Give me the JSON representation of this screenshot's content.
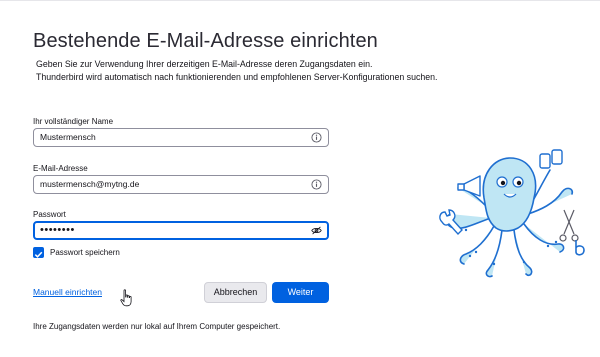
{
  "page": {
    "title": "Bestehende E-Mail-Adresse einrichten",
    "description_line1": "Geben Sie zur Verwendung Ihrer derzeitigen E-Mail-Adresse deren Zugangsdaten ein.",
    "description_line2": "Thunderbird wird automatisch nach funktionierenden und empfohlenen Server-Konfigurationen suchen."
  },
  "form": {
    "name": {
      "label": "Ihr vollständiger Name",
      "value": "Mustermensch"
    },
    "email": {
      "label": "E-Mail-Adresse",
      "value": "mustermensch@mytng.de"
    },
    "password": {
      "label": "Passwort",
      "masked_value": "••••••••"
    },
    "remember_password": {
      "label": "Passwort speichern",
      "checked": true
    }
  },
  "actions": {
    "manual_setup_link": "Manuell einrichten",
    "cancel_label": "Abbrechen",
    "continue_label": "Weiter"
  },
  "footer": {
    "note": "Ihre Zugangsdaten werden nur lokal auf Ihrem Computer gespeichert."
  },
  "colors": {
    "accent": "#0061e0",
    "octopus": "#bfe6f4",
    "octopus_outline": "#1f6fd0"
  },
  "icons": [
    "info-icon",
    "info-icon",
    "eye-icon",
    "checkmark-icon",
    "hand-cursor-icon"
  ]
}
